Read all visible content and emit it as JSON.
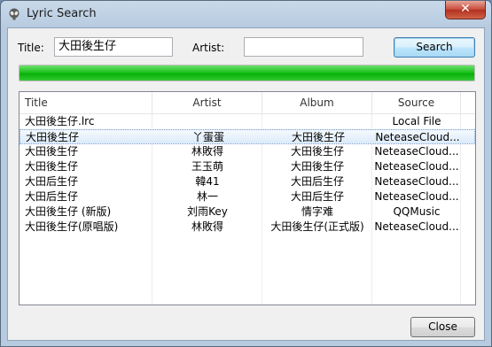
{
  "window": {
    "title": "Lyric Search",
    "close_glyph": "✕"
  },
  "search": {
    "title_label": "Title:",
    "title_value": "大田後生仔",
    "artist_label": "Artist:",
    "artist_value": "",
    "search_button": "Search"
  },
  "progress": {
    "fraction": 1.0,
    "color": "#06b206"
  },
  "table": {
    "columns": [
      "Title",
      "Artist",
      "Album",
      "Source"
    ],
    "selected_index": 1,
    "rows": [
      {
        "title": "大田後生仔.lrc",
        "artist": "",
        "album": "",
        "source": "Local File"
      },
      {
        "title": "大田後生仔",
        "artist": "丫蛋蛋",
        "album": "大田後生仔",
        "source": "NeteaseCloud..."
      },
      {
        "title": "大田後生仔",
        "artist": "林敗得",
        "album": "大田後生仔",
        "source": "NeteaseCloud..."
      },
      {
        "title": "大田後生仔",
        "artist": "王玉萌",
        "album": "大田後生仔",
        "source": "NeteaseCloud..."
      },
      {
        "title": "大田后生仔",
        "artist": "韓41",
        "album": "大田后生仔",
        "source": "NeteaseCloud..."
      },
      {
        "title": "大田后生仔",
        "artist": "林一",
        "album": "大田后生仔",
        "source": "NeteaseCloud..."
      },
      {
        "title": "大田後生仔 (新版)",
        "artist": "刘雨Key",
        "album": "情字难",
        "source": "QQMusic"
      },
      {
        "title": "大田後生仔(原唱版)",
        "artist": "林敗得",
        "album": "大田後生仔(正式版)",
        "source": "NeteaseCloud..."
      }
    ]
  },
  "footer": {
    "close_button": "Close"
  }
}
